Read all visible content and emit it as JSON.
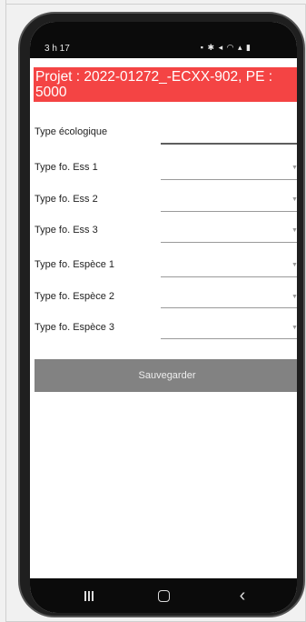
{
  "status_bar": {
    "time": "3 h 17",
    "icons": [
      "notification-icon",
      "bluetooth-icon",
      "mute-icon",
      "wifi-icon",
      "signal-icon",
      "battery-icon"
    ]
  },
  "header": {
    "title": "Projet : 2022-01272_-ECXX-902, PE : 5000",
    "color": "#f44444"
  },
  "form": {
    "fields": [
      {
        "label": "Type écologique"
      },
      {
        "label": "Type fo. Ess 1"
      },
      {
        "label": "Type fo. Ess 2"
      },
      {
        "label": "Type fo. Ess 3"
      },
      {
        "label": "Type fo. Espèce 1"
      },
      {
        "label": "Type fo. Espèce 2"
      },
      {
        "label": "Type fo. Espèce 3"
      }
    ],
    "dropdown_arrow": "▼",
    "save_label": "Sauvegarder"
  },
  "nav_bar": {
    "back_glyph": "‹"
  }
}
